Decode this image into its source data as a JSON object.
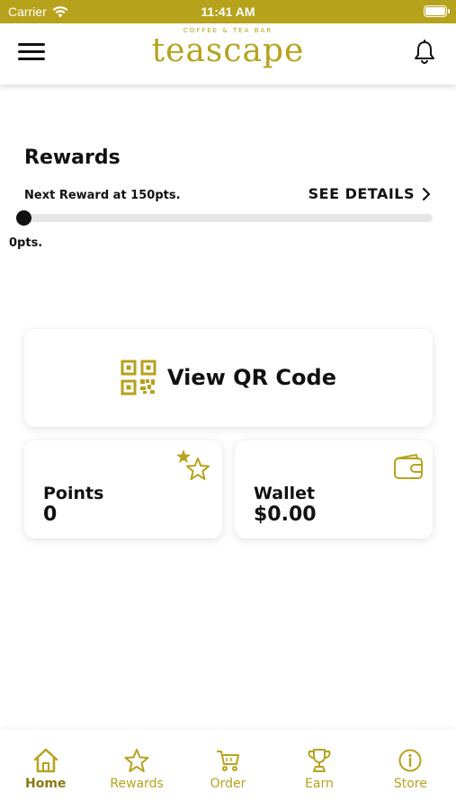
{
  "status_bar": {
    "carrier": "Carrier",
    "time": "11:41 AM",
    "icons": [
      "wifi-icon",
      "battery-icon"
    ]
  },
  "header": {
    "logo_tagline": "COFFEE & TEA BAR",
    "logo_name": "teascape",
    "icons": [
      "hamburger-menu-icon",
      "bell-icon"
    ]
  },
  "rewards": {
    "title": "Rewards",
    "next_reward": "Next Reward at 150pts.",
    "see_details": "SEE DETAILS",
    "current_points_label": "0pts.",
    "progress_fraction": 0
  },
  "qr_card": {
    "label": "View QR Code",
    "icon": "qr-code-icon"
  },
  "points_card": {
    "title": "Points",
    "value": "0",
    "icon": "stars-icon"
  },
  "wallet_card": {
    "title": "Wallet",
    "value": "$0.00",
    "icon": "wallet-icon"
  },
  "bottom_nav": {
    "items": [
      {
        "label": "Home",
        "icon": "home-icon",
        "active": true
      },
      {
        "label": "Rewards",
        "icon": "star-icon",
        "active": false
      },
      {
        "label": "Order",
        "icon": "cart-icon",
        "active": false
      },
      {
        "label": "Earn",
        "icon": "trophy-icon",
        "active": false
      },
      {
        "label": "Store",
        "icon": "info-icon",
        "active": false
      }
    ]
  },
  "colors": {
    "accent": "#b7a21c",
    "text": "#111111",
    "track": "#e6e6e6",
    "background": "#ffffff"
  }
}
